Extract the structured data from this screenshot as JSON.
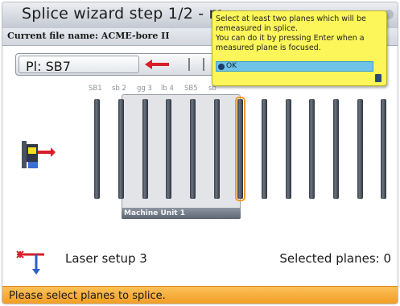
{
  "window": {
    "title": "Splice wizard step 1/2 - m",
    "file_label": "Current file name: ACME-bore II"
  },
  "selector": {
    "plane_value": "Pl: SB7",
    "arrow_icon": "red-arrow-left-icon"
  },
  "tooltip": {
    "lines": [
      "Select at least two planes which will be",
      "remeasured in splice.",
      "You can do it by pressing Enter when a",
      "measured plane is focused."
    ],
    "ok_label": "OK"
  },
  "planes": {
    "names": [
      "SB1",
      "sb 2",
      "gg 3",
      "lb 4",
      "SB5",
      "sb"
    ],
    "highlighted_index": 6,
    "count": 13
  },
  "machine_unit": {
    "label": "Machine Unit 1"
  },
  "footer": {
    "laser_setup": "Laser setup 3",
    "selected_planes": "Selected planes: 0"
  },
  "status": {
    "message": "Please select planes to splice."
  },
  "colors": {
    "tooltip_bg": "#fcf65a",
    "status_bg": "#f29a1f",
    "highlight": "#f29a28",
    "arrow_red": "#d81e28"
  }
}
